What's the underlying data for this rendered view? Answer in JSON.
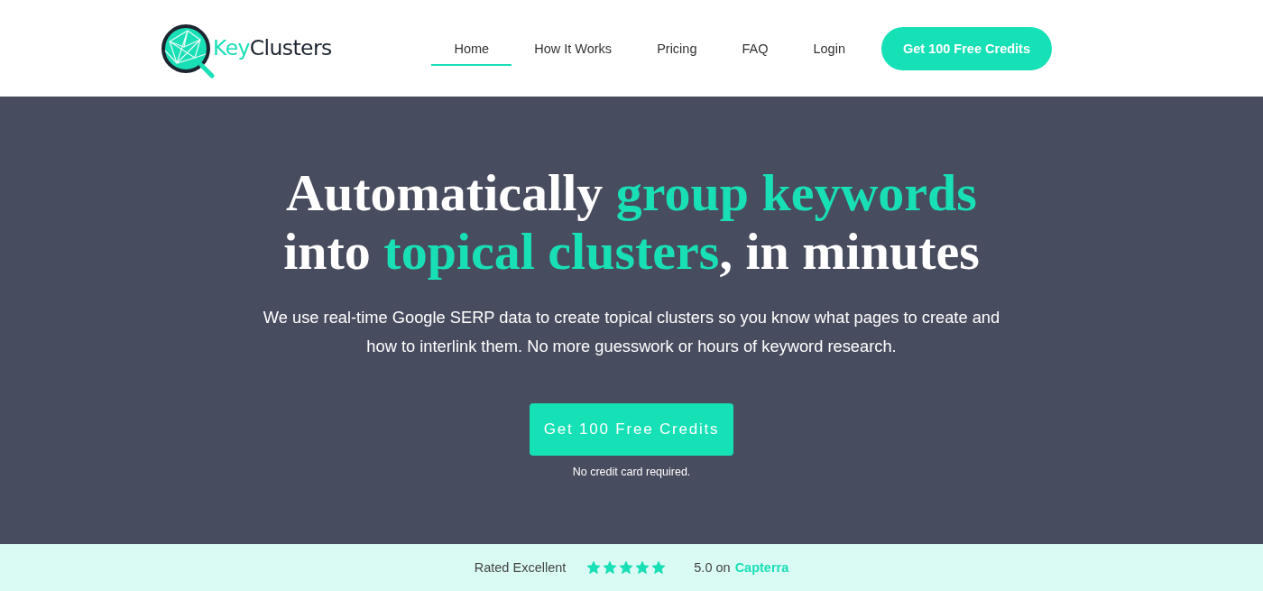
{
  "header": {
    "logo": {
      "part_1": "Key",
      "part_2": "Clusters"
    },
    "nav": [
      {
        "label": "Home",
        "selected": true
      },
      {
        "label": "How It Works",
        "selected": false
      },
      {
        "label": "Pricing",
        "selected": false
      },
      {
        "label": "FAQ",
        "selected": false
      },
      {
        "label": "Login",
        "selected": false
      }
    ],
    "cta": "Get 100 Free Credits"
  },
  "hero": {
    "headline": [
      [
        {
          "text": "Automatically ",
          "highlight": false
        },
        {
          "text": "group keywords",
          "highlight": true
        }
      ],
      [
        {
          "text": "into ",
          "highlight": false
        },
        {
          "text": "topical clusters",
          "highlight": true
        },
        {
          "text": ", in minutes",
          "highlight": false
        }
      ]
    ],
    "subtitle": "We use real-time Google SERP data to create topical clusters so you know what pages to create and how to interlink them. No more guesswork or hours of keyword research.",
    "cta": "Get 100 Free Credits",
    "note": "No credit card required."
  },
  "rating": {
    "label": "Rated Excellent",
    "stars": 5,
    "score": "5.0 on",
    "source": "Capterra"
  }
}
